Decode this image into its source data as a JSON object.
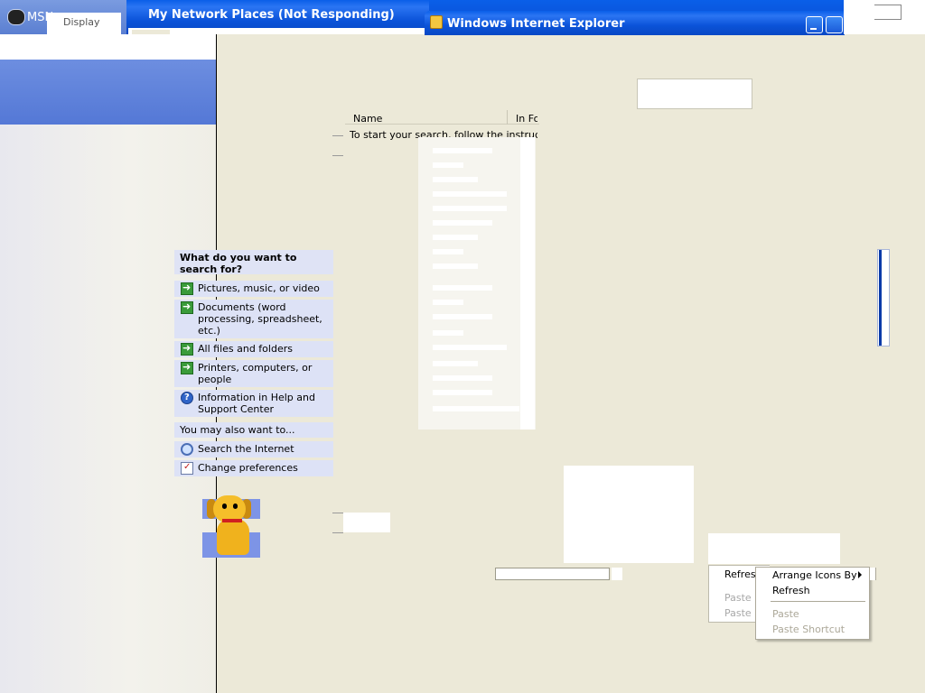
{
  "msn_window": {
    "title": "MSN"
  },
  "display_tab": {
    "label": "Display"
  },
  "network_places_window": {
    "title": "My Network Places (Not Responding)"
  },
  "ie_window": {
    "title": "Windows Internet Explorer"
  },
  "search_companion": {
    "heading": "What do you want to search for?",
    "options": [
      {
        "label": "Pictures, music, or video",
        "icon": "arrow-icon"
      },
      {
        "label": "Documents (word processing, spreadsheet, etc.)",
        "icon": "arrow-icon"
      },
      {
        "label": "All files and folders",
        "icon": "arrow-icon"
      },
      {
        "label": "Printers, computers, or people",
        "icon": "arrow-icon"
      },
      {
        "label": "Information in Help and Support Center",
        "icon": "help-icon"
      }
    ],
    "also_heading": "You may also want to...",
    "also_options": [
      {
        "label": "Search the Internet",
        "icon": "search-icon"
      },
      {
        "label": "Change preferences",
        "icon": "preferences-icon"
      }
    ]
  },
  "results_list": {
    "columns": [
      "Name",
      "In Folder"
    ],
    "message": "To start your search, follow the instructions in the left pane."
  },
  "background_menu": {
    "items": [
      {
        "label": "Refresh",
        "enabled": true
      },
      {
        "label": "Paste",
        "enabled": false
      },
      {
        "label": "Paste Shortcut",
        "enabled": false
      }
    ]
  },
  "context_menu": {
    "items": [
      {
        "label": "Arrange Icons By",
        "enabled": true,
        "submenu": true
      },
      {
        "label": "Refresh",
        "enabled": true
      },
      {
        "label": "Paste",
        "enabled": false
      },
      {
        "label": "Paste Shortcut",
        "enabled": false
      }
    ]
  }
}
